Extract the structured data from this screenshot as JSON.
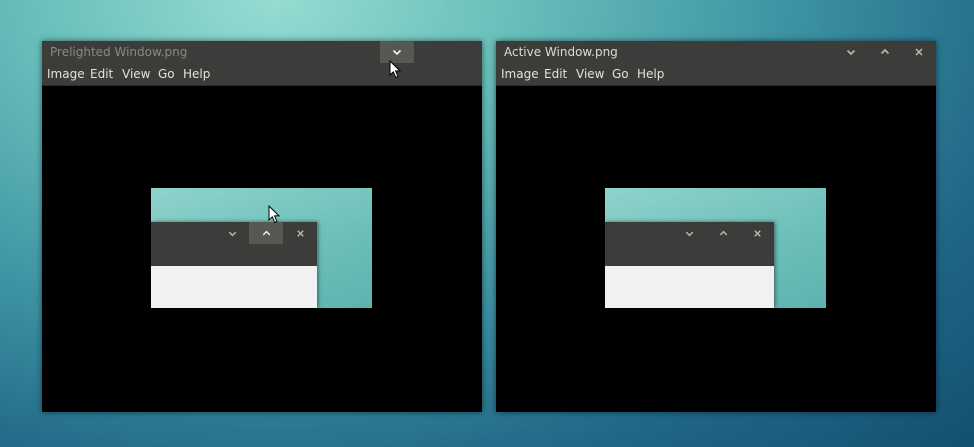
{
  "windows": [
    {
      "id": "prelighted",
      "title": "Prelighted Window.png",
      "menu": [
        "Image",
        "Edit",
        "View",
        "Go",
        "Help"
      ]
    },
    {
      "id": "active",
      "title": "Active Window.png",
      "menu": [
        "Image",
        "Edit",
        "View",
        "Go",
        "Help"
      ]
    }
  ],
  "icons": {
    "minimize": "chevron-down-icon",
    "maximize": "chevron-up-icon",
    "close": "close-icon",
    "pointer": "mouse-pointer-icon"
  },
  "colors": {
    "titlebar": "#3c3c3a",
    "hover_button": "#575754",
    "thumbnail_body": "#f1f1f2"
  }
}
